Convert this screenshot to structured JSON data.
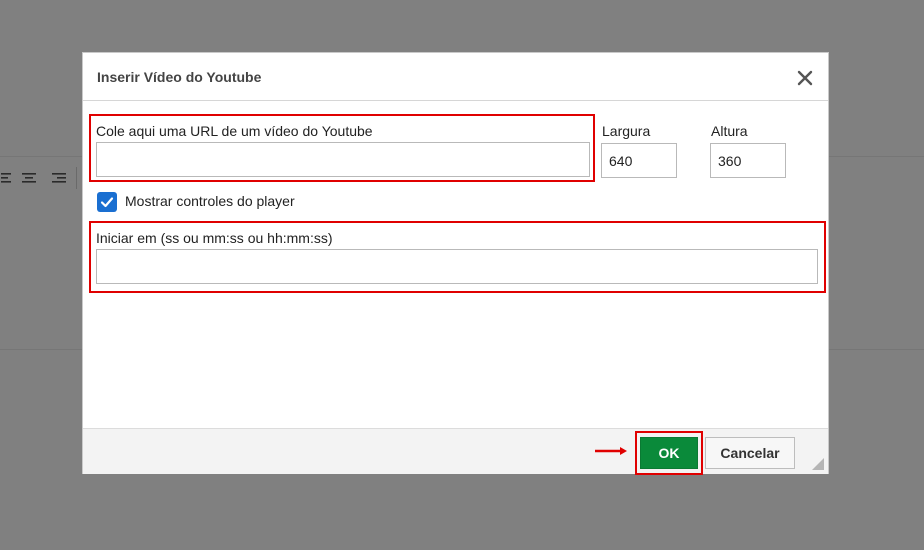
{
  "dialog": {
    "title": "Inserir Vídeo do Youtube",
    "close_icon": "close-icon"
  },
  "fields": {
    "url_label": "Cole aqui uma URL de um vídeo do Youtube",
    "url_value": "",
    "width_label": "Largura",
    "width_value": "640",
    "height_label": "Altura",
    "height_value": "360",
    "show_controls_label": "Mostrar controles do player",
    "show_controls_checked": true,
    "start_label": "Iniciar em (ss ou mm:ss ou hh:mm:ss)",
    "start_value": ""
  },
  "footer": {
    "ok_label": "OK",
    "cancel_label": "Cancelar"
  },
  "colors": {
    "overlay": "#808080",
    "highlight": "#e00000",
    "ok_button": "#0a8a3a",
    "checkbox": "#1a6fd1"
  }
}
